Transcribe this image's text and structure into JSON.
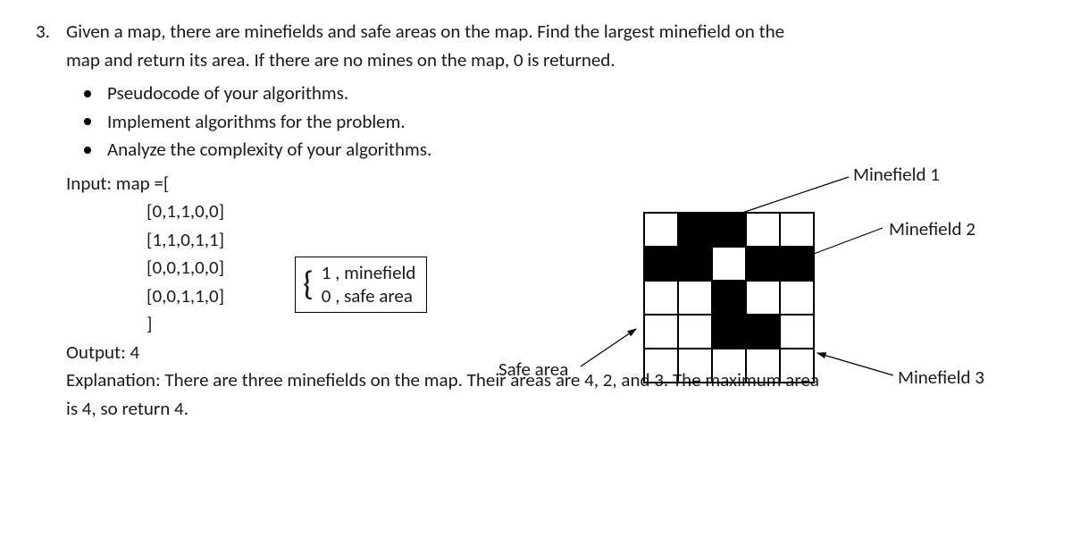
{
  "question": {
    "number": "3.",
    "text_line1": "Given a map, there are minefields and safe areas on the map.    Find the largest minefield on the",
    "text_line2": "map and return its area. If there are no mines on the map, 0 is returned.",
    "bullets": [
      "Pseudocode of your algorithms.",
      "Implement algorithms for the problem.",
      "Analyze the complexity of your algorithms."
    ],
    "input_label": "Input:   map =[",
    "input_rows": [
      "[0,1,1,0,0]",
      "[1,1,0,1,1]",
      "[0,0,1,0,0]",
      "[0,0,1,1,0]",
      "]"
    ],
    "output_label": "Output: 4",
    "explanation_line1": "Explanation: There are three minefields on the map. Their areas are 4, 2, and 3. The maximum area",
    "explanation_line2": "is 4, so return 4."
  },
  "legend": {
    "row1": "1    , minefield",
    "row2": "0    , safe area"
  },
  "labels": {
    "minefield1": "Minefield 1",
    "minefield2": "Minefield 2",
    "minefield3": "Minefield 3",
    "safe_area": "Safe area"
  },
  "grid": {
    "rows": 5,
    "cols": 5,
    "mines": [
      [
        0,
        1
      ],
      [
        0,
        2
      ],
      [
        1,
        0
      ],
      [
        1,
        1
      ],
      [
        1,
        3
      ],
      [
        1,
        4
      ],
      [
        2,
        2
      ],
      [
        3,
        2
      ],
      [
        3,
        3
      ]
    ]
  }
}
